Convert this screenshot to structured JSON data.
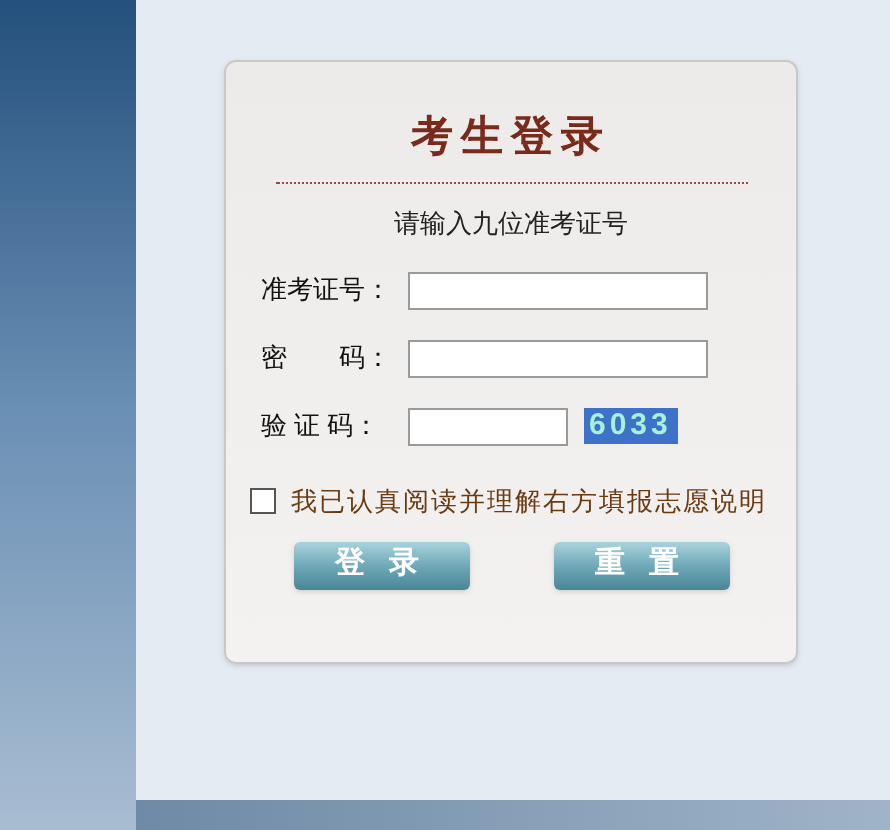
{
  "login": {
    "title": "考生登录",
    "instruction": "请输入九位准考证号",
    "fields": [
      {
        "kind": "text",
        "label": "准考证号："
      },
      {
        "kind": "password",
        "label": "密　　码："
      },
      {
        "kind": "captcha",
        "label": "验 证 码：",
        "code": "6033"
      }
    ],
    "agreement": {
      "label": "我已认真阅读并理解右方填报志愿说明",
      "checked": false
    },
    "buttons": [
      "登 录",
      "重 置"
    ]
  }
}
